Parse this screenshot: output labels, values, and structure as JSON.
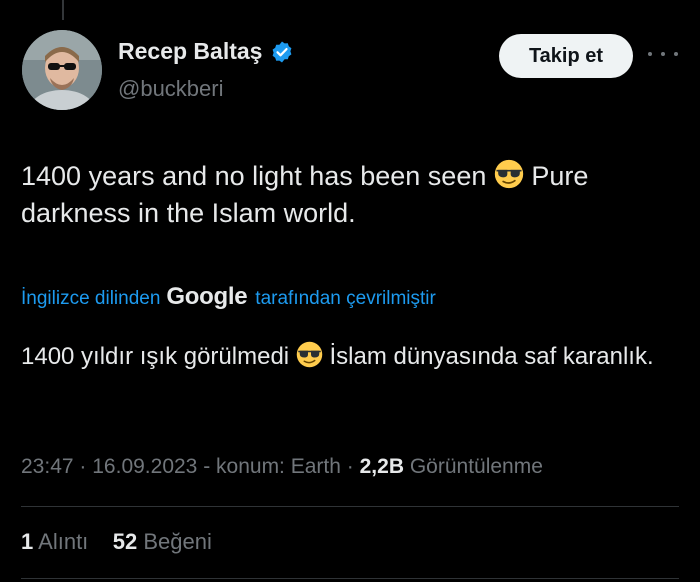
{
  "author": {
    "display_name": "Recep Baltaş",
    "handle": "@buckberi",
    "verified": true
  },
  "follow_button_label": "Takip et",
  "tweet": {
    "text_part1": "1400 years and no light has been seen",
    "text_part2": "Pure darkness in the Islam world."
  },
  "translation": {
    "prefix": "İngilizce dilinden",
    "provider": "Google",
    "suffix": "tarafından çevrilmiştir",
    "text_part1": "1400 yıldır ışık görülmedi",
    "text_part2": "İslam dünyasında saf karanlık."
  },
  "meta": {
    "time": "23:47",
    "sep1": "·",
    "date": "16.09.2023",
    "location": "- konum: Earth",
    "sep2": "·",
    "views_count": "2,2B",
    "views_label": "Görüntülenme"
  },
  "stats": {
    "quotes_count": "1",
    "quotes_label": "Alıntı",
    "likes_count": "52",
    "likes_label": "Beğeni"
  },
  "icons": {
    "emoji": "smiling-face-with-sunglasses",
    "verified": "verified-badge-icon",
    "more": "more-horizontal-icon"
  },
  "colors": {
    "background": "#000000",
    "text": "#e7e9ea",
    "muted": "#71767b",
    "accent": "#1d9bf0",
    "button_bg": "#eff3f4"
  }
}
